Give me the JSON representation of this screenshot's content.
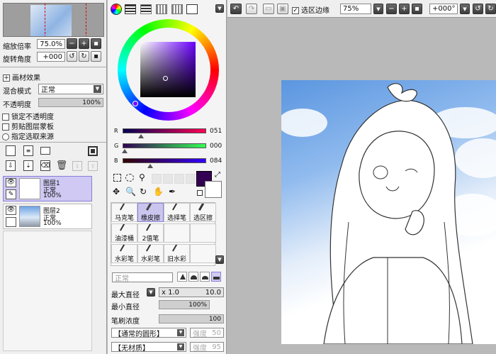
{
  "navigator": {
    "zoom_label": "缩放倍率",
    "zoom_value": "75.0%",
    "rotate_label": "旋转角度",
    "rotate_value": "+000"
  },
  "layer_props": {
    "effects_label": "画材效果",
    "blend_label": "混合模式",
    "blend_value": "正常",
    "opacity_label": "不透明度",
    "opacity_value": "100%",
    "lock_opacity": "锁定不透明度",
    "clip_mask": "剪贴图层蒙板",
    "selection_source": "指定选取来源"
  },
  "layers": [
    {
      "name": "图层1",
      "mode": "正常",
      "opacity": "100%"
    },
    {
      "name": "图层2",
      "mode": "正常",
      "opacity": "100%"
    }
  ],
  "color": {
    "r_label": "R",
    "r_value": "051",
    "g_label": "G",
    "g_value": "000",
    "b_label": "B",
    "b_value": "084",
    "primary": "#330054"
  },
  "tools": [
    {
      "label": "马克笔"
    },
    {
      "label": "橡皮擦"
    },
    {
      "label": "选择笔"
    },
    {
      "label": "选区擦"
    },
    {
      "label": "油漆桶"
    },
    {
      "label": "2值笔"
    },
    {
      "label": ""
    },
    {
      "label": ""
    },
    {
      "label": "水彩笔"
    },
    {
      "label": "水彩笔"
    },
    {
      "label": "旧水彩"
    },
    {
      "label": ""
    }
  ],
  "brush": {
    "mode_value": "正常",
    "max_size_label": "最大直径",
    "max_size_mult": "x 1.0",
    "max_size_value": "10.0",
    "min_size_label": "最小直径",
    "min_size_value": "100%",
    "density_label": "笔刷浓度",
    "density_value": "100",
    "shape_value": "【通常的圆形】",
    "shape_strength_label": "强度",
    "shape_strength_value": "50",
    "texture_value": "【无材质】",
    "texture_strength_label": "强度",
    "texture_strength_value": "95"
  },
  "toolbar": {
    "selection_edge_label": "选区边缘",
    "zoom_value": "75%",
    "rotate_value": "+000°"
  },
  "colors": {
    "accent_purple": "#330054",
    "selection_highlight": "#cfc9f3",
    "canvas_bg": "#b9b9b9"
  }
}
